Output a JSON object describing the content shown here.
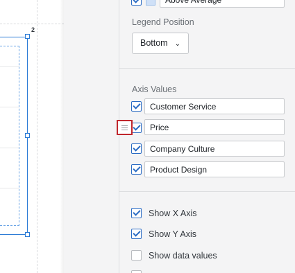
{
  "canvas": {
    "index_label": "2"
  },
  "panel": {
    "legend_items": [
      {
        "label": "Above Average",
        "checked": true,
        "swatch_color": "#cfe0f7"
      }
    ],
    "legend_position": {
      "label": "Legend Position",
      "value": "Bottom"
    },
    "axis_values": {
      "label": "Axis Values",
      "items": [
        {
          "label": "Customer Service",
          "checked": true
        },
        {
          "label": "Price",
          "checked": true
        },
        {
          "label": "Company Culture",
          "checked": true
        },
        {
          "label": "Product Design",
          "checked": true
        }
      ]
    },
    "options": [
      {
        "label": "Show X Axis",
        "checked": true
      },
      {
        "label": "Show Y Axis",
        "checked": true
      },
      {
        "label": "Show data values",
        "checked": false
      }
    ]
  },
  "colors": {
    "accent": "#2b6cc4",
    "selection": "#2b7bd6",
    "highlight_box": "#c0262d",
    "panel_bg": "#f4f4f5"
  },
  "icons": {
    "drag_handle": "drag-handle-icon",
    "dropdown": "chevron-down-icon"
  }
}
